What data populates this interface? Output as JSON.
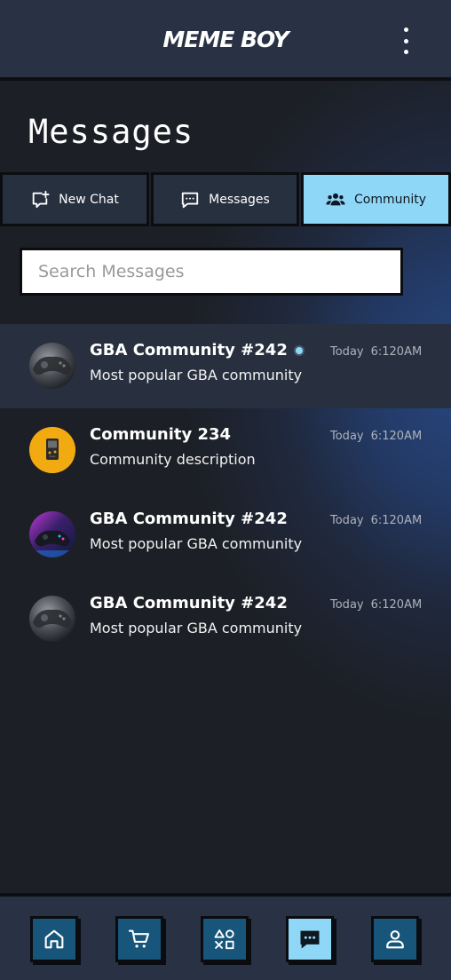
{
  "header": {
    "logo": "MEME BOY",
    "menu_icon": "kebab-menu-icon"
  },
  "page": {
    "title": "Messages"
  },
  "tabs": [
    {
      "label": "New Chat",
      "icon": "new-chat-icon",
      "active": false
    },
    {
      "label": "Messages",
      "icon": "chat-bubble-icon",
      "active": false
    },
    {
      "label": "Community",
      "icon": "users-icon",
      "active": true
    }
  ],
  "search": {
    "placeholder": "Search Messages",
    "value": ""
  },
  "chats": [
    {
      "title": "GBA Community #242",
      "description": "Most popular GBA community",
      "day": "Today",
      "time": "6:120AM",
      "unread": true,
      "avatar": "game-controller-avatar"
    },
    {
      "title": "Community 234",
      "description": "Community description",
      "day": "Today",
      "time": "6:120AM",
      "unread": false,
      "avatar": "gameboy-avatar"
    },
    {
      "title": "GBA Community #242",
      "description": "Most popular GBA community",
      "day": "Today",
      "time": "6:120AM",
      "unread": false,
      "avatar": "neon-controller-avatar"
    },
    {
      "title": "GBA Community #242",
      "description": "Most popular GBA community",
      "day": "Today",
      "time": "6:120AM",
      "unread": false,
      "avatar": "game-controller-avatar"
    }
  ],
  "bottom_nav": [
    {
      "icon": "home-icon",
      "active": false
    },
    {
      "icon": "cart-icon",
      "active": false
    },
    {
      "icon": "games-icon",
      "active": false
    },
    {
      "icon": "chat-icon",
      "active": true
    },
    {
      "icon": "profile-icon",
      "active": false
    }
  ],
  "colors": {
    "accent": "#8fd7f7",
    "header_bg": "#283244",
    "nav_button": "#17567a",
    "background": "#1c1f25"
  }
}
